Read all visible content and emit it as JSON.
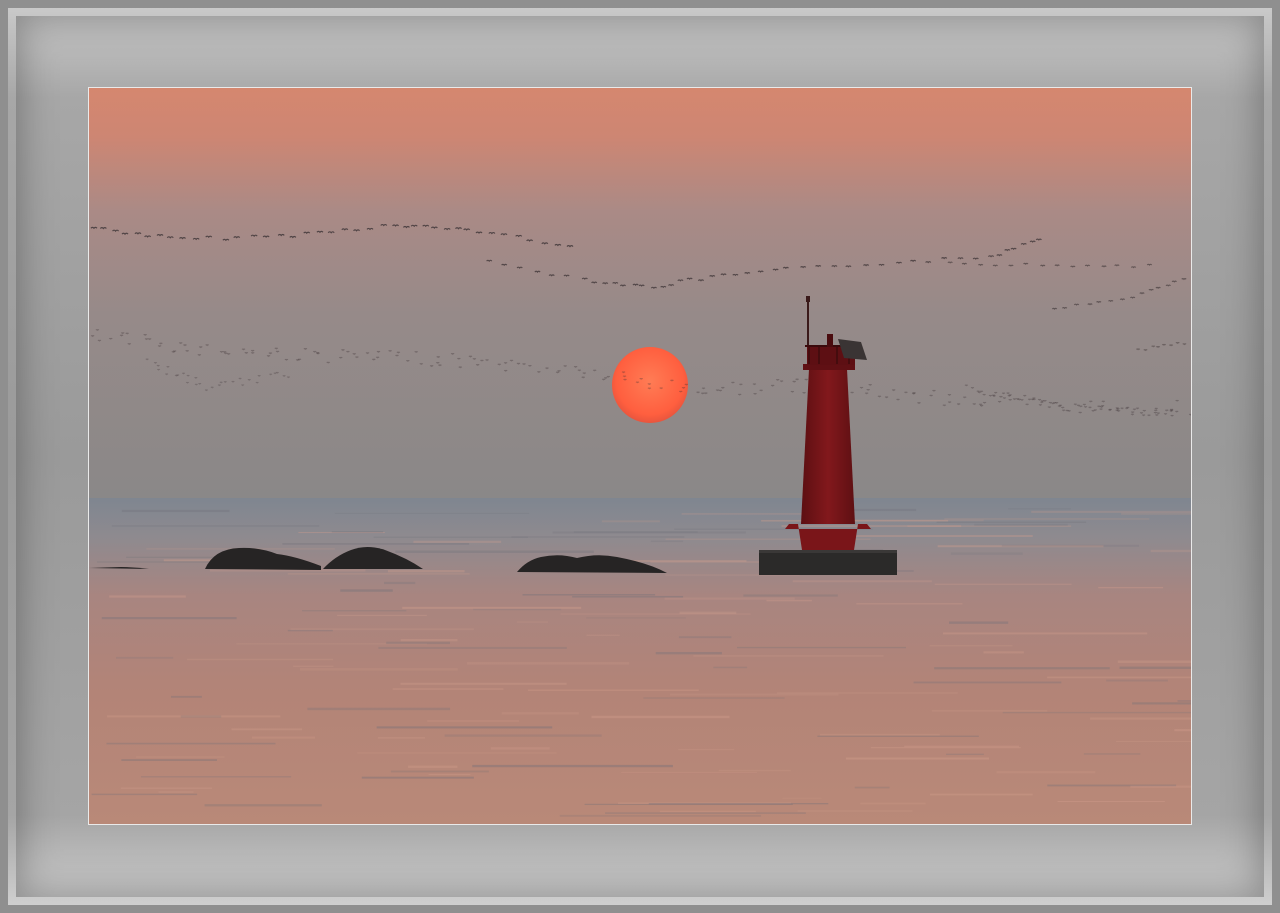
{
  "image": {
    "alt": "",
    "colors": {
      "frame": "#9a9a9a",
      "sky_top": "#d98a70",
      "sky_mid": "#a18b88",
      "sky_horizon": "#8b8785",
      "sea_far": "#8c8f96",
      "sea_near": "#b88474",
      "sun": "#ff6a4a",
      "lighthouse": "#7a1518",
      "rock": "#262424"
    },
    "elements": [
      "sun",
      "lighthouse",
      "rocks",
      "sea",
      "flock-of-birds"
    ]
  }
}
